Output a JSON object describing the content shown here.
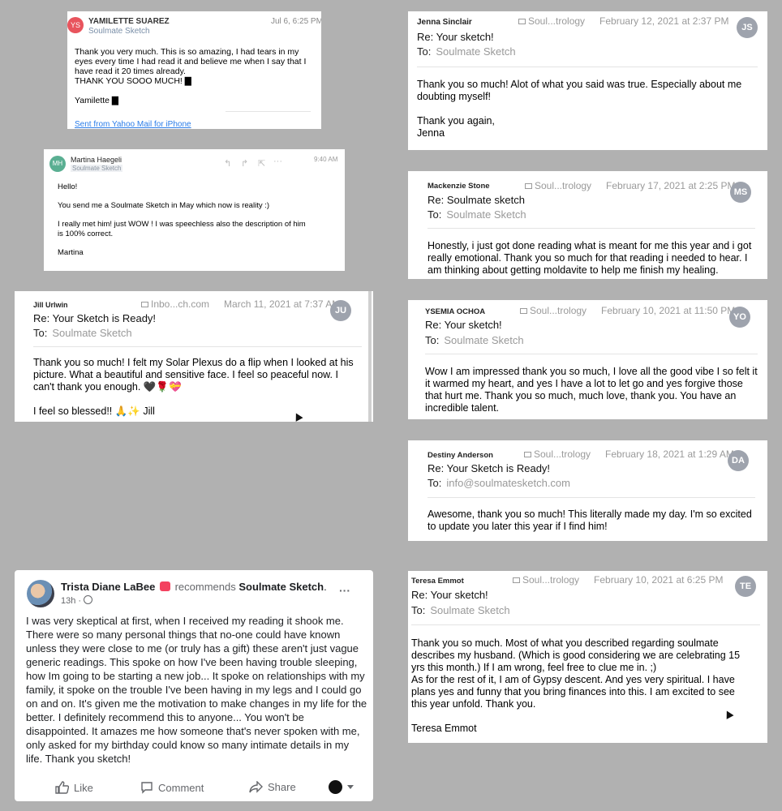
{
  "yamilette": {
    "avatar": "YS",
    "avatar_color": "#e8545d",
    "name": "YAMILETTE SUAREZ",
    "sender_group": "Soulmate Sketch",
    "time": "Jul 6, 6:25 PM",
    "body": "Thank you very much. This is so amazing, I had tears in my\neyes every time I had read it and believe me when I say that I\nhave read it 20 times already.\nTHANK YOU SOOO MUCH! ▇\n\nYamilette ▇",
    "footer_link": "Sent from Yahoo Mail for iPhone"
  },
  "martina": {
    "avatar": "MH",
    "avatar_color": "#5aaf92",
    "name": "Martina Haegeli",
    "sender_group": "Soulmate Sketch",
    "time": "9:40 AM",
    "icons": [
      "reply-icon",
      "forward-icon",
      "move-icon",
      "more-icon"
    ],
    "body": "Hello!\n\nYou send me a Soulmate Sketch in May which now is reality :)\n\nI really met him! just WOW ! I was speechless also the description of him\nis 100% correct.\n\nMartina"
  },
  "jill": {
    "name": "Jill Urlwin",
    "folder": "Inbo...ch.com",
    "date": "March 11, 2021 at 7:37 AM",
    "avatar": "JU",
    "subject": "Re: Your Sketch is Ready!",
    "to_label": "To:",
    "to": "Soulmate Sketch",
    "body": "Thank you so much!  I felt my Solar Plexus do a flip when I looked at his\npicture.  What a beautiful and sensitive face.  I feel so peaceful now.  I\ncan't thank you enough. 🖤🌹💝\n\nI feel so blessed!! 🙏✨  Jill"
  },
  "jenna": {
    "name": "Jenna Sinclair",
    "folder": "Soul...trology",
    "date": "February 12, 2021 at 2:37 PM",
    "avatar": "JS",
    "subject": "Re: Your sketch!",
    "to_label": "To:",
    "to": "Soulmate Sketch",
    "body": "Thank you so much! Alot of what you said was true. Especially about me\ndoubting myself!\n\nThank you again,\nJenna"
  },
  "mackenzie": {
    "name": "Mackenzie Stone",
    "folder": "Soul...trology",
    "date": "February 17, 2021 at 2:25 PM",
    "avatar": "MS",
    "subject": "Re: Soulmate sketch",
    "to_label": "To:",
    "to": "Soulmate Sketch",
    "body": "Honestly, i just got done reading what is meant for me this year and i got\nreally emotional. Thank you so much for that reading i needed to hear. I\nam thinking about getting moldavite to help me finish my healing."
  },
  "ysemia": {
    "name": "YSEMIA OCHOA",
    "folder": "Soul...trology",
    "date": "February 10, 2021 at 11:50 PM",
    "avatar": "YO",
    "subject": "Re: Your sketch!",
    "to_label": "To:",
    "to": "Soulmate Sketch",
    "body": "Wow I am impressed thank you so much, I love all the good vibe I so felt it\nit warmed my heart, and yes I have a lot to let go and yes forgive those\nthat hurt me. Thank you so much, much love, thank you. You have an\nincredible talent."
  },
  "destiny": {
    "name": "Destiny Anderson",
    "folder": "Soul...trology",
    "date": "February 18, 2021 at 1:29 AM",
    "avatar": "DA",
    "subject": "Re: Your Sketch is Ready!",
    "to_label": "To:",
    "to": "info@soulmatesketch.com",
    "body": "Awesome, thank you so much! This literally made my day. I'm so excited\nto update you later this year if I find him!"
  },
  "teresa": {
    "name": "Teresa Emmot",
    "folder": "Soul...trology",
    "date": "February 10, 2021 at 6:25 PM",
    "avatar": "TE",
    "subject": "Re: Your sketch!",
    "to_label": "To:",
    "to": "Soulmate Sketch",
    "body": "Thank you so much.  Most of what you described regarding soulmate\ndescribes my husband.  (Which is good considering we are celebrating 15\nyrs this month.) If I am wrong, feel free to clue me in.  ;)\nAs for the rest of it, I am of Gypsy descent.  And yes very spiritual.  I have\nplans yes and funny that you bring finances into this.  I am excited to see\nthis year unfold.  Thank you.\n\nTeresa Emmot"
  },
  "facebook": {
    "name": "Trista Diane LaBee",
    "verb": "recommends",
    "page": "Soulmate Sketch",
    "time": "13h ·",
    "more": "···",
    "body": "I was very skeptical at first, when I received my reading it shook me.\nThere were so many personal things that no-one could have known\nunless they were close to me (or truly has a gift) these aren't just vague\ngeneric readings. This spoke on how I've been having trouble sleeping,\nhow Im going to be starting a new job... It spoke on relationships with my\nfamily, it spoke on the trouble I've been having in my legs and I could go\non and on. It's given me the motivation to make changes in my life for the\nbetter. I definitely recommend this to anyone... You won't be\ndisappointed. It amazes me how someone that's never spoken with me,\nonly asked for my birthday could know so many intimate details in my\nlife. Thank you sketch!",
    "like": "Like",
    "comment": "Comment",
    "share": "Share",
    "recommend_color": "#f3425f"
  },
  "colors": {
    "background": "#b1b1b1",
    "link": "#2b7de9",
    "avatar_gray": "#9ea3ad"
  }
}
